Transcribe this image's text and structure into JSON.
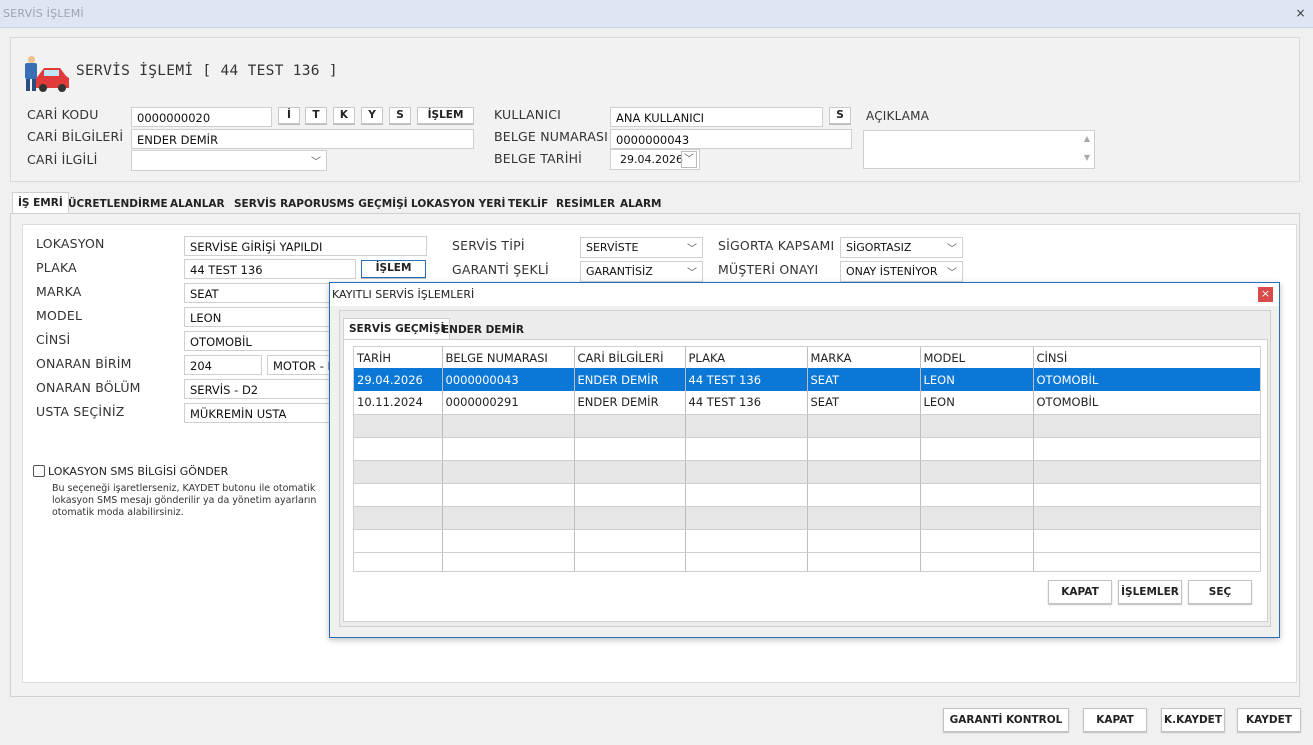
{
  "window": {
    "title": "SERVİS İŞLEMİ",
    "close": "×"
  },
  "header": {
    "title": "SERVİS İŞLEMİ [ 44 TEST 136 ]",
    "cari_kodu_label": "CARİ KODU",
    "cari_kodu_value": "0000000020",
    "cari_buttons": [
      "İ",
      "T",
      "K",
      "Y",
      "S",
      "İŞLEM"
    ],
    "cari_bilgileri_label": "CARİ BİLGİLERİ",
    "cari_bilgileri_value": "ENDER DEMİR",
    "cari_ilgili_label": "CARİ İLGİLİ",
    "cari_ilgili_value": "",
    "kullanici_label": "KULLANICI",
    "kullanici_value": "ANA KULLANICI",
    "kullanici_button": "S",
    "belge_no_label": "BELGE NUMARASI",
    "belge_no_value": "0000000043",
    "belge_tarihi_label": "BELGE TARİHİ",
    "belge_tarihi_value": "29.04.2026",
    "aciklama_label": "AÇIKLAMA",
    "aciklama_value": ""
  },
  "tabs": [
    "İŞ EMRİ",
    "ÜCRETLENDİRME",
    "ALANLAR",
    "SERVİS RAPORU",
    "SMS GEÇMİŞİ",
    "LOKASYON YERİ",
    "TEKLİF",
    "RESİMLER",
    "ALARM"
  ],
  "form": {
    "lokasyon_label": "LOKASYON",
    "lokasyon_value": "SERVİSE GİRİŞİ YAPILDI",
    "plaka_label": "PLAKA",
    "plaka_value": "44 TEST 136",
    "plaka_button": "İŞLEM",
    "marka_label": "MARKA",
    "marka_value": "SEAT",
    "model_label": "MODEL",
    "model_value": "LEON",
    "cinsi_label": "CİNSİ",
    "cinsi_value": "OTOMOBİL",
    "onaran_birim_label": "ONARAN BİRİM",
    "onaran_birim_code": "204",
    "onaran_birim_name": "MOTOR - M",
    "onaran_bolum_label": "ONARAN BÖLÜM",
    "onaran_bolum_value": "SERVİS - D2",
    "usta_label": "USTA SEÇİNİZ",
    "usta_value": "MÜKREMİN USTA",
    "servis_tipi_label": "SERVİS TİPİ",
    "servis_tipi_value": "SERVİSTE",
    "garanti_label": "GARANTİ ŞEKLİ",
    "garanti_value": "GARANTİSİZ",
    "sigorta_label": "SİGORTA KAPSAMI",
    "sigorta_value": "SİGORTASIZ",
    "musteri_label": "MÜŞTERİ ONAYI",
    "musteri_value": "ONAY İSTENİYOR",
    "sms_checkbox_label": "LOKASYON SMS BİLGİSİ GÖNDER",
    "sms_help_1": "Bu seçeneği işaretlerseniz, KAYDET butonu ile otomatik",
    "sms_help_2": "lokasyon SMS mesajı gönderilir ya da yönetim ayarların",
    "sms_help_3": "otomatik moda alabilirsiniz."
  },
  "dialog": {
    "title": "KAYITLI SERVİS İŞLEMLERİ",
    "close": "×",
    "tabs": [
      "SERVİS GEÇMİŞİ",
      "ENDER DEMİR"
    ],
    "columns": [
      "TARİH",
      "BELGE NUMARASI",
      "CARİ BİLGİLERİ",
      "PLAKA",
      "MARKA",
      "MODEL",
      "CİNSİ"
    ],
    "rows": [
      [
        "29.04.2026",
        "0000000043",
        "ENDER DEMİR",
        "44 TEST 136",
        "SEAT",
        "LEON",
        "OTOMOBİL"
      ],
      [
        "10.11.2024",
        "0000000291",
        "ENDER DEMİR",
        "44 TEST 136",
        "SEAT",
        "LEON",
        "OTOMOBİL"
      ]
    ],
    "buttons": {
      "kapat": "KAPAT",
      "islemler": "İŞLEMLER",
      "sec": "SEÇ"
    }
  },
  "footer": {
    "garanti": "GARANTİ KONTROL",
    "kapat": "KAPAT",
    "kkaydet": "K.KAYDET",
    "kaydet": "KAYDET"
  },
  "colors": {
    "selection": "#0b78d7",
    "dialog_border": "#2b6cb8",
    "title_text": "#9aa6b6"
  },
  "icons": {
    "logo": "mechanic-car-icon"
  }
}
